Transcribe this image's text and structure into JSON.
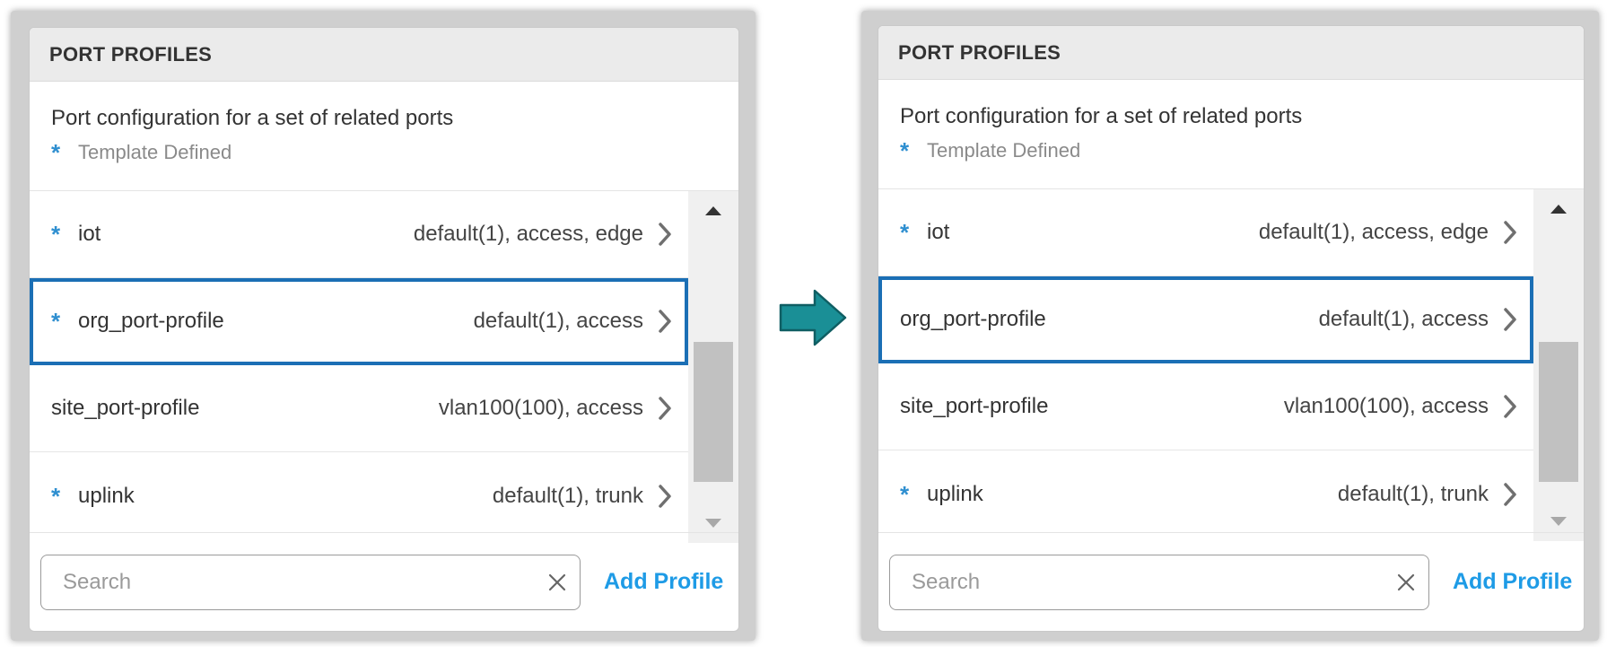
{
  "colors": {
    "accent_star": "#2f8fd0",
    "selection_border": "#1b6fb5",
    "link": "#1e9be6",
    "arrow_fill": "#1a8f96"
  },
  "icons": {
    "star": "star-icon",
    "chevron": "chevron-right-icon",
    "clear": "close-icon",
    "transition": "arrow-right-icon"
  },
  "panels": [
    {
      "title": "PORT PROFILES",
      "description": "Port configuration for a set of related ports",
      "legend": "Template Defined",
      "rows": [
        {
          "name": "iot",
          "template": true,
          "summary": "default(1), access, edge",
          "selected": false
        },
        {
          "name": "org_port-profile",
          "template": true,
          "summary": "default(1), access",
          "selected": true
        },
        {
          "name": "site_port-profile",
          "template": false,
          "summary": "vlan100(100), access",
          "selected": false
        },
        {
          "name": "uplink",
          "template": true,
          "summary": "default(1), trunk",
          "selected": false
        }
      ],
      "search": {
        "placeholder": "Search",
        "value": ""
      },
      "add_label": "Add Profile"
    },
    {
      "title": "PORT PROFILES",
      "description": "Port configuration for a set of related ports",
      "legend": "Template Defined",
      "rows": [
        {
          "name": "iot",
          "template": true,
          "summary": "default(1), access, edge",
          "selected": false
        },
        {
          "name": "org_port-profile",
          "template": false,
          "summary": "default(1), access",
          "selected": true
        },
        {
          "name": "site_port-profile",
          "template": false,
          "summary": "vlan100(100), access",
          "selected": false
        },
        {
          "name": "uplink",
          "template": true,
          "summary": "default(1), trunk",
          "selected": false
        }
      ],
      "search": {
        "placeholder": "Search",
        "value": ""
      },
      "add_label": "Add Profile"
    }
  ]
}
